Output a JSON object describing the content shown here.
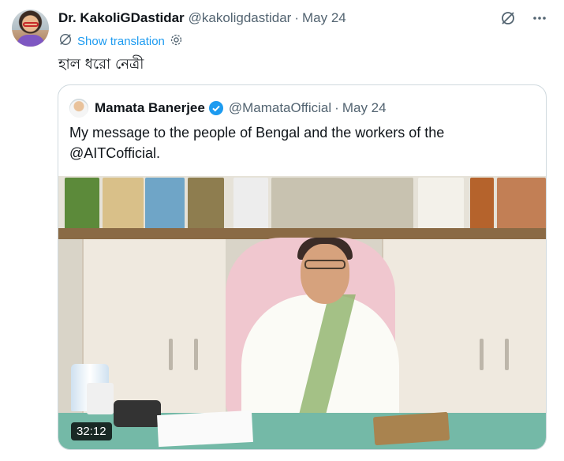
{
  "tweet": {
    "author_name": "Dr. KakoliGDastidar",
    "handle": "@kakoligdastidar",
    "separator": "·",
    "date": "May 24",
    "show_translation": "Show translation",
    "text": "হাল ধরো নেত্রী"
  },
  "quoted": {
    "author_name": "Mamata Banerjee",
    "handle": "@MamataOfficial",
    "separator": "·",
    "date": "May 24",
    "text": "My message to the people of Bengal and the workers of the @AITCofficial.",
    "video_duration": "32:12"
  },
  "icons": {
    "grok": "grok-icon",
    "more": "more-horizontal-icon",
    "translate": "translate-icon",
    "settings": "gear-icon",
    "verified": "verified-badge-icon"
  },
  "colors": {
    "link": "#1d9bf0",
    "secondary_text": "#536471",
    "verified": "#1d9bf0"
  }
}
